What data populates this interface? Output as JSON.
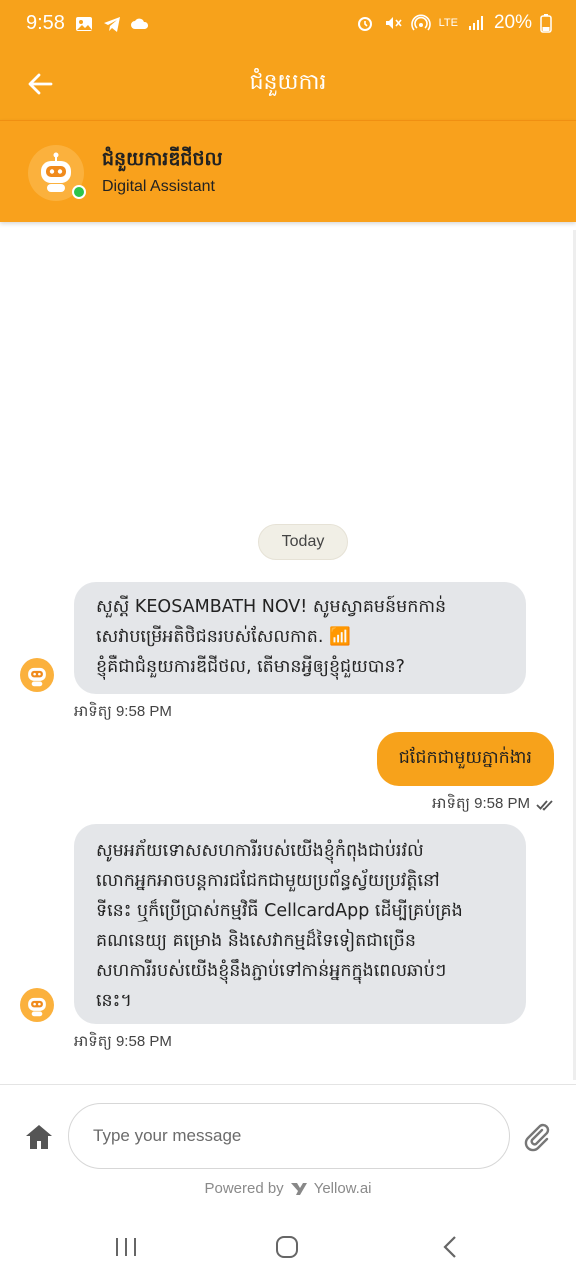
{
  "status_bar": {
    "time": "9:58",
    "battery": "20%",
    "network": "LTE"
  },
  "header": {
    "title": "ជំនួយការ"
  },
  "bot": {
    "name": "ជំនួយការឌីជីថល",
    "subtitle": "Digital Assistant",
    "status": "online"
  },
  "chat": {
    "date_separator": "Today",
    "messages": [
      {
        "sender": "bot",
        "lines": [
          "សួស្តី KEOSAMBATH NOV! សូមស្វាគមន៍មកកាន់",
          "សេវាបម្រើអតិថិជនរបស់សែលកាត. 📶",
          "ខ្ញុំគឺជាជំនួយការឌីជីថល, តើមានអ្វីឲ្យខ្ញុំជួយបាន?"
        ],
        "time": "អាទិត្យ 9:58 PM"
      },
      {
        "sender": "user",
        "text": "ជជែកជាមួយភ្នាក់ងារ",
        "time": "អាទិត្យ 9:58 PM"
      },
      {
        "sender": "bot",
        "lines": [
          "សូមអភ័យទោសសហការីរបស់យើងខ្ញុំកំពុងជាប់រវល់",
          "លោកអ្នកអាចបន្តការជជែកជាមួយប្រព័ន្ធស្វ័យប្រវត្តិនៅ",
          "ទីនេះ ឬក៏ប្រើប្រាស់កម្មវិធី CellcardApp ដើម្បីគ្រប់គ្រង",
          "គណនេយ្យ គម្រោង និងសេវាកម្មដ៏ទៃទៀតជាច្រើន",
          "សហការីរបស់យើងខ្ញុំនឹងភ្ជាប់ទៅកាន់អ្នកក្នុងពេលឆាប់ៗ",
          "នេះ។"
        ],
        "time": "អាទិត្យ 9:58 PM"
      }
    ]
  },
  "composer": {
    "placeholder": "Type your message"
  },
  "footer": {
    "powered_by": "Powered by",
    "brand": "Yellow.ai"
  },
  "colors": {
    "accent": "#f7a21b",
    "bot_bubble": "#e4e6e9",
    "online": "#2ec44a"
  },
  "icons": [
    "arrow-left-icon",
    "robot-icon",
    "home-icon",
    "paperclip-icon",
    "double-check-icon",
    "yellow-ai-logo-icon"
  ]
}
